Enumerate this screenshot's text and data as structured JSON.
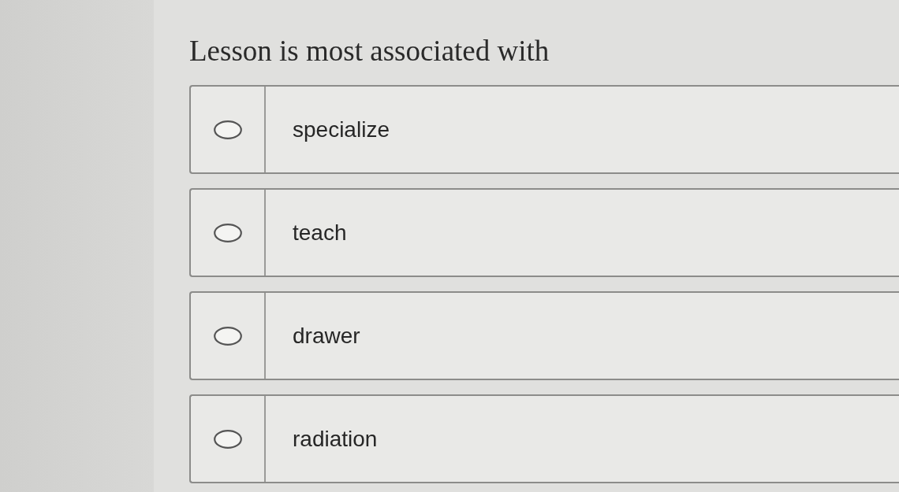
{
  "question": "Lesson is most associated with",
  "options": [
    {
      "label": "specialize",
      "selected": false
    },
    {
      "label": "teach",
      "selected": false
    },
    {
      "label": "drawer",
      "selected": false
    },
    {
      "label": "radiation",
      "selected": false
    }
  ]
}
